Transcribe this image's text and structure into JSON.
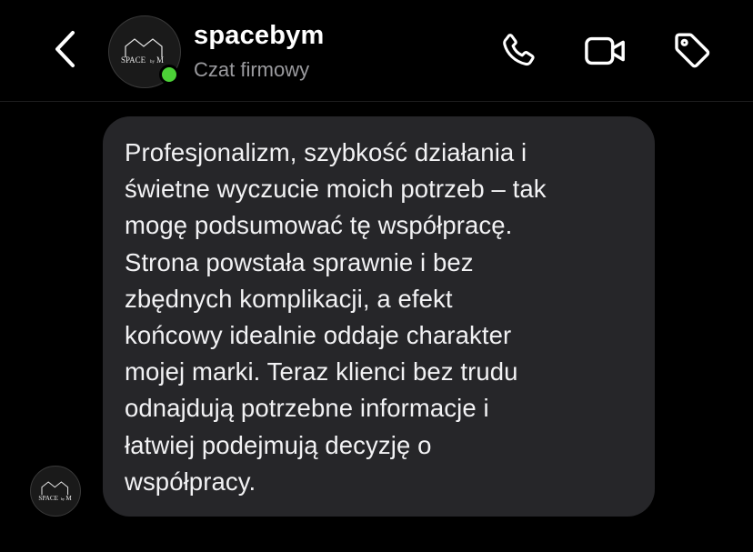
{
  "header": {
    "name": "spacebym",
    "subtitle": "Czat firmowy",
    "online": true,
    "online_color": "#4cd137",
    "logo_text_left": "SPACE",
    "logo_text_mid": "by",
    "logo_text_right": "M"
  },
  "icons": {
    "back": "chevron-left-icon",
    "call": "phone-icon",
    "video": "video-camera-icon",
    "tag": "tag-icon"
  },
  "messages": [
    {
      "sender": "spacebym",
      "text": "Profesjonalizm, szybkość działania i\nświetne wyczucie moich potrzeb – tak\nmogę podsumować tę współpracę.\nStrona powstała sprawnie i bez\nzbędnych komplikacji, a efekt\nkońcowy idealnie oddaje charakter\nmojej marki. Teraz klienci bez trudu\nodnajdują potrzebne informacje i\nłatwiej podejmują decyzję o\nwspółpracy."
    }
  ],
  "colors": {
    "background": "#000000",
    "bubble": "#262629",
    "subtitle": "#9a9a9e"
  }
}
